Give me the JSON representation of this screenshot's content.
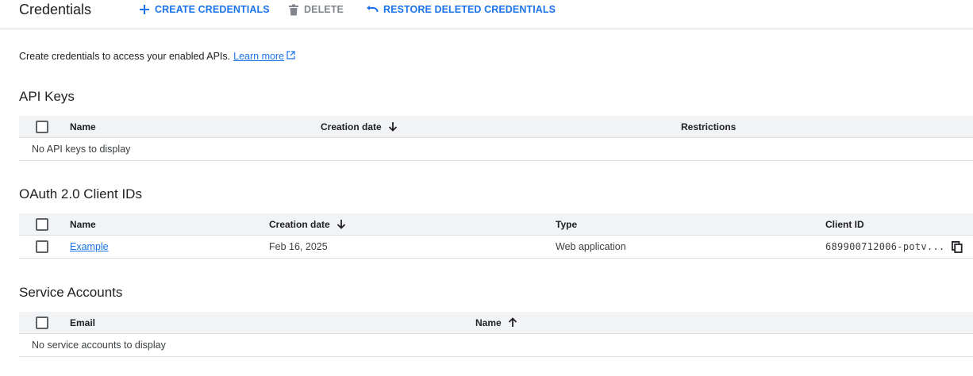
{
  "toolbar": {
    "title": "Credentials",
    "create_label": "CREATE CREDENTIALS",
    "delete_label": "DELETE",
    "restore_label": "RESTORE DELETED CREDENTIALS"
  },
  "intro": {
    "text": "Create credentials to access your enabled APIs.",
    "link_text": "Learn more"
  },
  "api_keys": {
    "title": "API Keys",
    "columns": [
      "Name",
      "Creation date",
      "Restrictions"
    ],
    "empty_text": "No API keys to display"
  },
  "oauth": {
    "title": "OAuth 2.0 Client IDs",
    "columns": [
      "Name",
      "Creation date",
      "Type",
      "Client ID"
    ],
    "rows": [
      {
        "name": "Example",
        "creation_date": "Feb 16, 2025",
        "type": "Web application",
        "client_id": "689900712006-potv..."
      }
    ]
  },
  "service_accounts": {
    "title": "Service Accounts",
    "columns": [
      "Email",
      "Name"
    ],
    "empty_text": "No service accounts to display"
  },
  "colors": {
    "accent": "#1a73e8",
    "disabled": "#80868b",
    "header_bg": "#f1f3f4",
    "divider": "#e0e0e0"
  },
  "icons": {
    "create": "plus-icon",
    "delete": "trash-icon",
    "restore": "undo-icon",
    "external": "open-in-new-icon",
    "sort_desc": "arrow-down-icon",
    "sort_asc": "arrow-up-icon",
    "copy": "copy-icon"
  }
}
